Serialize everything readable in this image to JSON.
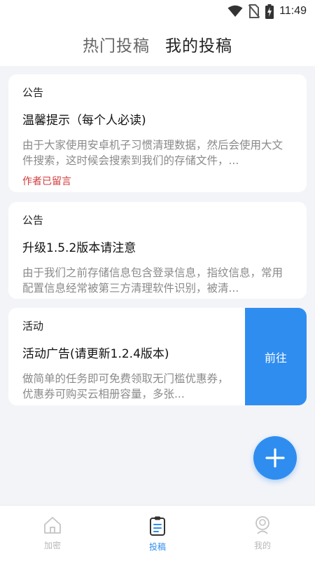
{
  "status_bar": {
    "time": "11:49",
    "icons": [
      "wifi-icon",
      "no-sim-icon",
      "battery-charging-icon"
    ]
  },
  "header": {
    "tabs": [
      {
        "label": "热门投稿",
        "active": false
      },
      {
        "label": "我的投稿",
        "active": true
      }
    ]
  },
  "posts": [
    {
      "type": "公告",
      "title": "温馨提示（每个人必读)",
      "description": "由于大家使用安卓机子习惯清理数据，然后会使用大文件搜索，这时候会搜索到我们的存储文件，...",
      "note": "作者已留言"
    },
    {
      "type": "公告",
      "title": "升级1.5.2版本请注意",
      "description": "由于我们之前存储信息包含登录信息，指纹信息，常用配置信息经常被第三方清理软件识别，被清..."
    },
    {
      "type": "活动",
      "title": "活动广告(请更新1.2.4版本)",
      "description": "做简单的任务即可免费领取无门槛优惠券，优惠券可购买云相册容量，多张...",
      "action_label": "前往"
    }
  ],
  "fab": {
    "icon": "plus-icon"
  },
  "bottom_nav": {
    "items": [
      {
        "label": "加密",
        "icon": "home-icon",
        "active": false
      },
      {
        "label": "投稿",
        "icon": "clipboard-icon",
        "active": true
      },
      {
        "label": "我的",
        "icon": "profile-icon",
        "active": false
      }
    ]
  },
  "colors": {
    "accent": "#2f8df0",
    "note_red": "#d23b3b",
    "background": "#f3f4f8"
  }
}
